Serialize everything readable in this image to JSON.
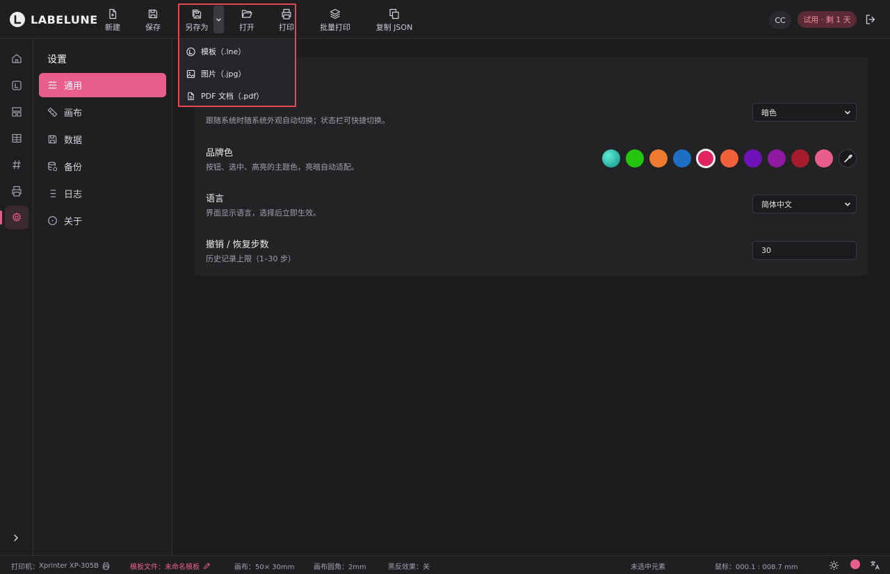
{
  "app": {
    "name": "LABELUNE"
  },
  "toolbar": {
    "new_label": "新建",
    "save_label": "保存",
    "save_as_label": "另存为",
    "open_label": "打开",
    "print_label": "打印",
    "batch_print_label": "批量打印",
    "copy_json_label": "复制 JSON"
  },
  "save_as_menu": {
    "items": [
      {
        "label": "模板（.lne）",
        "icon": "template-icon"
      },
      {
        "label": "图片（.jpg）",
        "icon": "image-icon"
      },
      {
        "label": "PDF 文档（.pdf）",
        "icon": "document-icon"
      }
    ]
  },
  "header": {
    "avatar_text": "CC",
    "trial_badge": "试用 · 剩 1 天"
  },
  "rail": {
    "items": [
      "home-icon",
      "template-icon",
      "layout-icon",
      "table-icon",
      "hash-icon",
      "printer-icon",
      "gear-icon"
    ],
    "active": "gear-icon"
  },
  "settings_nav": {
    "title": "设置",
    "items": [
      {
        "label": "通用",
        "icon": "sliders-icon",
        "active": true
      },
      {
        "label": "画布",
        "icon": "ruler-icon"
      },
      {
        "label": "数据",
        "icon": "save-icon"
      },
      {
        "label": "备份",
        "icon": "database-icon"
      },
      {
        "label": "日志",
        "icon": "list-icon"
      },
      {
        "label": "关于",
        "icon": "info-icon"
      }
    ]
  },
  "general": {
    "appearance": {
      "desc": "跟随系统时随系统外观自动切换；状态栏可快捷切换。",
      "value": "暗色"
    },
    "brand_color": {
      "title": "品牌色",
      "desc": "按钮、选中、高亮的主题色，亮暗自动适配。",
      "swatches": [
        "#14b8a6",
        "#22c40e",
        "#f07a2e",
        "#1d6fc4",
        "#e0245e",
        "#f2623a",
        "#6d13b8",
        "#8e1aa1",
        "#a51d2d",
        "#e85d8a"
      ],
      "selected": "#e0245e"
    },
    "language": {
      "title": "语言",
      "desc": "界面显示语言，选择后立即生效。",
      "value": "简体中文"
    },
    "undo": {
      "title": "撤销 / 恢复步数",
      "desc": "历史记录上限（1–30 步）",
      "value": "30"
    }
  },
  "status_bar": {
    "printer_label": "打印机：",
    "printer_value": "Xprinter XP-305B",
    "template_label": "模板文件：",
    "template_value": "未命名模板",
    "canvas": "画布：50× 30mm",
    "corner": "画布圆角：2mm",
    "invert": "黑反效果：关",
    "selection": "未选中元素",
    "mouse": "鼠标：000.1 : 008.7 mm"
  },
  "colors": {
    "accent": "#e85d8a",
    "background": "#1c1c1f",
    "panel": "#232326",
    "highlight_box": "#e5484d"
  }
}
